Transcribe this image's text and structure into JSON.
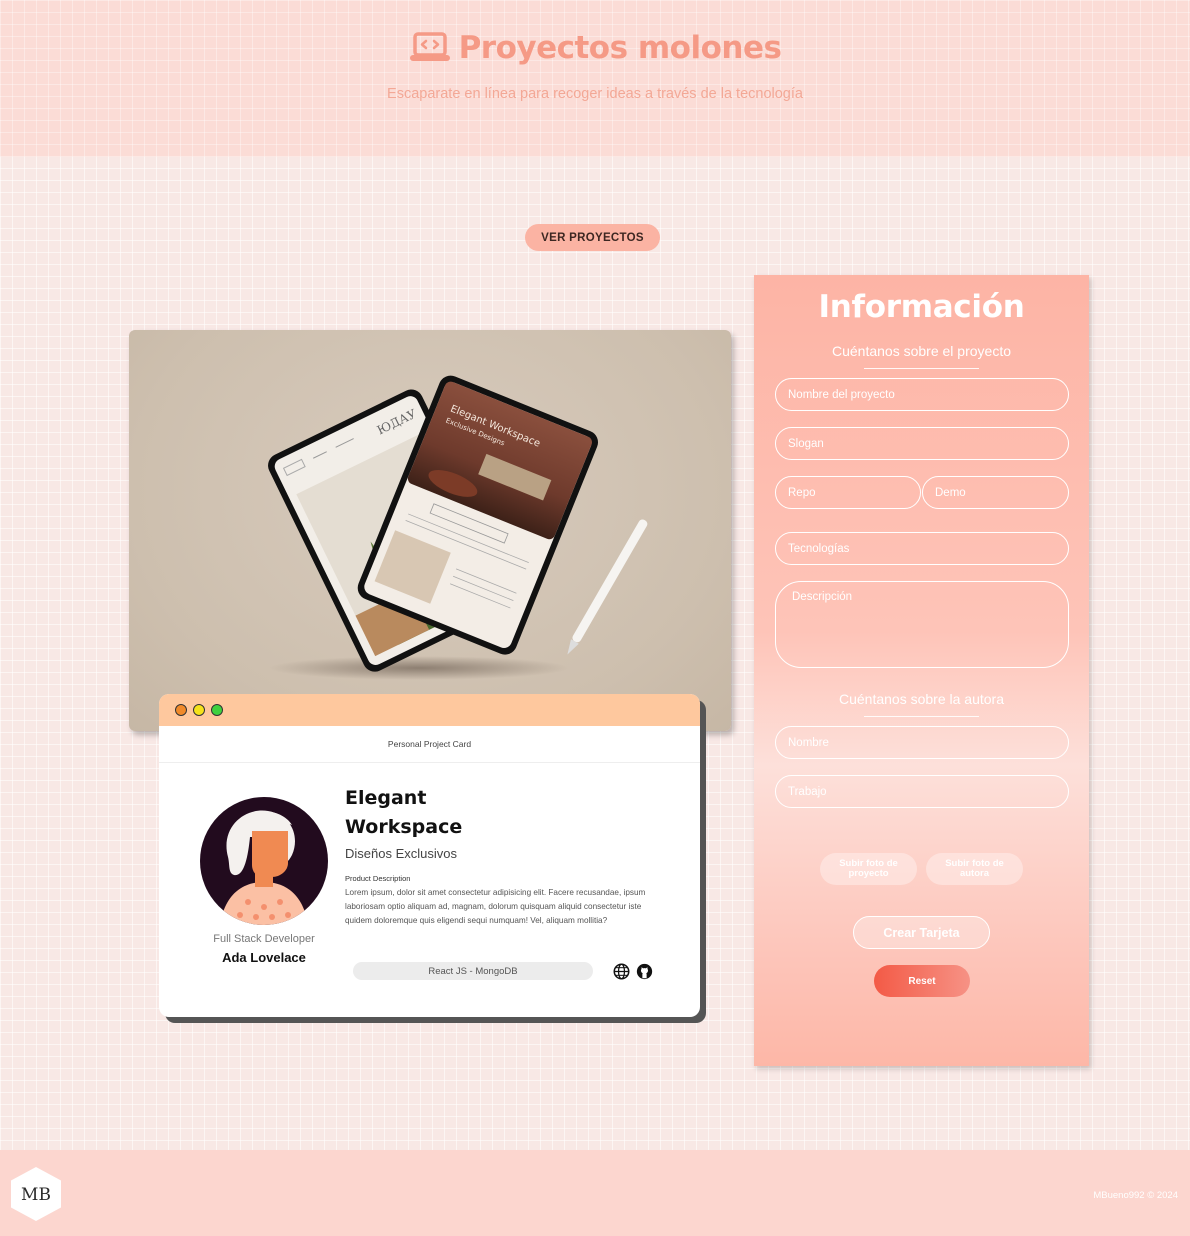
{
  "header": {
    "title": "Proyectos molones",
    "subtitle": "Escaparate en línea para recoger ideas a través de la tecnología"
  },
  "nav": {
    "ver_proyectos": "VER PROYECTOS"
  },
  "card": {
    "top_label": "Personal Project Card",
    "project_name": "Elegant Workspace",
    "slogan": "Diseños Exclusivos",
    "description_label": "Product Description",
    "description": "Lorem ipsum, dolor sit amet consectetur adipisicing elit. Facere recusandae, ipsum laboriosam optio aliquam ad, magnam, dolorum quisquam aliquid consectetur iste quidem doloremque quis eligendi sequi numquam! Vel, aliquam mollitia?",
    "technologies": "React JS - MongoDB",
    "author_job": "Full Stack Developer",
    "author_name": "Ada Lovelace",
    "window_dots": [
      "#f08a2a",
      "#f5e21b",
      "#3fd13f"
    ]
  },
  "form": {
    "title": "Información",
    "project_section": "Cuéntanos sobre el proyecto",
    "author_section": "Cuéntanos sobre la autora",
    "placeholders": {
      "name": "Nombre del proyecto",
      "slogan": "Slogan",
      "repo": "Repo",
      "demo": "Demo",
      "technologies": "Tecnologías",
      "description": "Descripción",
      "author_name": "Nombre",
      "job": "Trabajo"
    },
    "upload_project": "Subir foto de proyecto",
    "upload_author": "Subir foto de autora",
    "create": "Crear Tarjeta",
    "reset": "Reset"
  },
  "footer": {
    "logo_text": "MB",
    "copyright": "MBueno992 © 2024"
  },
  "colors": {
    "accent": "#f59a86",
    "header_bg": "#fbdcd6",
    "card_bar": "#fec89e",
    "reset": "#f35a46"
  }
}
